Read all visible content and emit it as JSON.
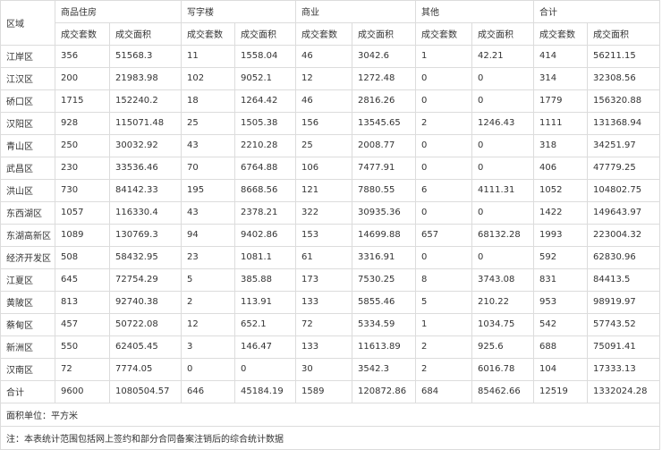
{
  "table": {
    "region_header": "区域",
    "groups": [
      "商品住房",
      "写字楼",
      "商业",
      "其他",
      "合计"
    ],
    "sub_headers": [
      "成交套数",
      "成交面积"
    ],
    "rows": [
      [
        "江岸区",
        "356",
        "51568.3",
        "11",
        "1558.04",
        "46",
        "3042.6",
        "1",
        "42.21",
        "414",
        "56211.15"
      ],
      [
        "江汉区",
        "200",
        "21983.98",
        "102",
        "9052.1",
        "12",
        "1272.48",
        "0",
        "0",
        "314",
        "32308.56"
      ],
      [
        "硚口区",
        "1715",
        "152240.2",
        "18",
        "1264.42",
        "46",
        "2816.26",
        "0",
        "0",
        "1779",
        "156320.88"
      ],
      [
        "汉阳区",
        "928",
        "115071.48",
        "25",
        "1505.38",
        "156",
        "13545.65",
        "2",
        "1246.43",
        "1111",
        "131368.94"
      ],
      [
        "青山区",
        "250",
        "30032.92",
        "43",
        "2210.28",
        "25",
        "2008.77",
        "0",
        "0",
        "318",
        "34251.97"
      ],
      [
        "武昌区",
        "230",
        "33536.46",
        "70",
        "6764.88",
        "106",
        "7477.91",
        "0",
        "0",
        "406",
        "47779.25"
      ],
      [
        "洪山区",
        "730",
        "84142.33",
        "195",
        "8668.56",
        "121",
        "7880.55",
        "6",
        "4111.31",
        "1052",
        "104802.75"
      ],
      [
        "东西湖区",
        "1057",
        "116330.4",
        "43",
        "2378.21",
        "322",
        "30935.36",
        "0",
        "0",
        "1422",
        "149643.97"
      ],
      [
        "东湖高新区",
        "1089",
        "130769.3",
        "94",
        "9402.86",
        "153",
        "14699.88",
        "657",
        "68132.28",
        "1993",
        "223004.32"
      ],
      [
        "经济开发区",
        "508",
        "58432.95",
        "23",
        "1081.1",
        "61",
        "3316.91",
        "0",
        "0",
        "592",
        "62830.96"
      ],
      [
        "江夏区",
        "645",
        "72754.29",
        "5",
        "385.88",
        "173",
        "7530.25",
        "8",
        "3743.08",
        "831",
        "84413.5"
      ],
      [
        "黄陂区",
        "813",
        "92740.38",
        "2",
        "113.91",
        "133",
        "5855.46",
        "5",
        "210.22",
        "953",
        "98919.97"
      ],
      [
        "蔡甸区",
        "457",
        "50722.08",
        "12",
        "652.1",
        "72",
        "5334.59",
        "1",
        "1034.75",
        "542",
        "57743.52"
      ],
      [
        "新洲区",
        "550",
        "62405.45",
        "3",
        "146.47",
        "133",
        "11613.89",
        "2",
        "925.6",
        "688",
        "75091.41"
      ],
      [
        "汉南区",
        "72",
        "7774.05",
        "0",
        "0",
        "30",
        "3542.3",
        "2",
        "6016.78",
        "104",
        "17333.13"
      ],
      [
        "合计",
        "9600",
        "1080504.57",
        "646",
        "45184.19",
        "1589",
        "120872.86",
        "684",
        "85462.66",
        "12519",
        "1332024.28"
      ]
    ],
    "unit_note": "面积单位：平方米",
    "footnote": "注：本表统计范围包括网上签约和部分合同备案注销后的综合统计数据"
  }
}
